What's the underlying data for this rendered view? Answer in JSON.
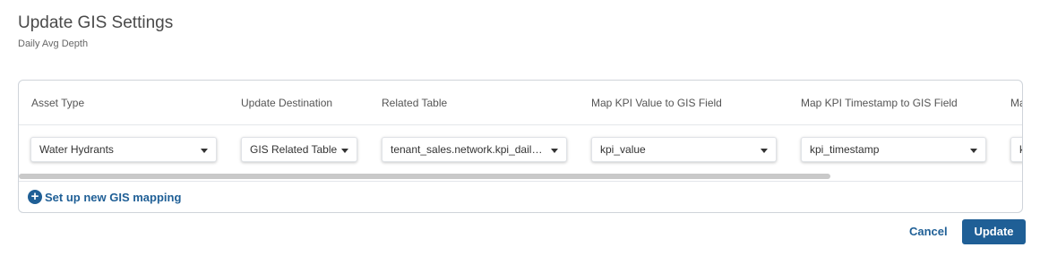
{
  "page": {
    "title": "Update GIS Settings",
    "subtitle": "Daily Avg Depth"
  },
  "table": {
    "headers": [
      "Asset Type",
      "Update Destination",
      "Related Table",
      "Map KPI Value to GIS Field",
      "Map KPI Timestamp to GIS Field",
      "Ma"
    ],
    "row": {
      "asset_type": "Water Hydrants",
      "update_destination": "GIS Related Table",
      "related_table": "tenant_sales.network.kpi_daily...",
      "kpi_value_field": "kpi_value",
      "kpi_timestamp_field": "kpi_timestamp",
      "partial_value": "k"
    }
  },
  "actions": {
    "add_mapping_icon": "+",
    "add_mapping_label": "Set up new GIS mapping",
    "cancel_label": "Cancel",
    "update_label": "Update"
  },
  "colors": {
    "accent": "#1f5f96",
    "border": "#cfd4da"
  },
  "icons": {
    "add": "plus-circle-icon",
    "dropdown": "caret-down-icon"
  }
}
